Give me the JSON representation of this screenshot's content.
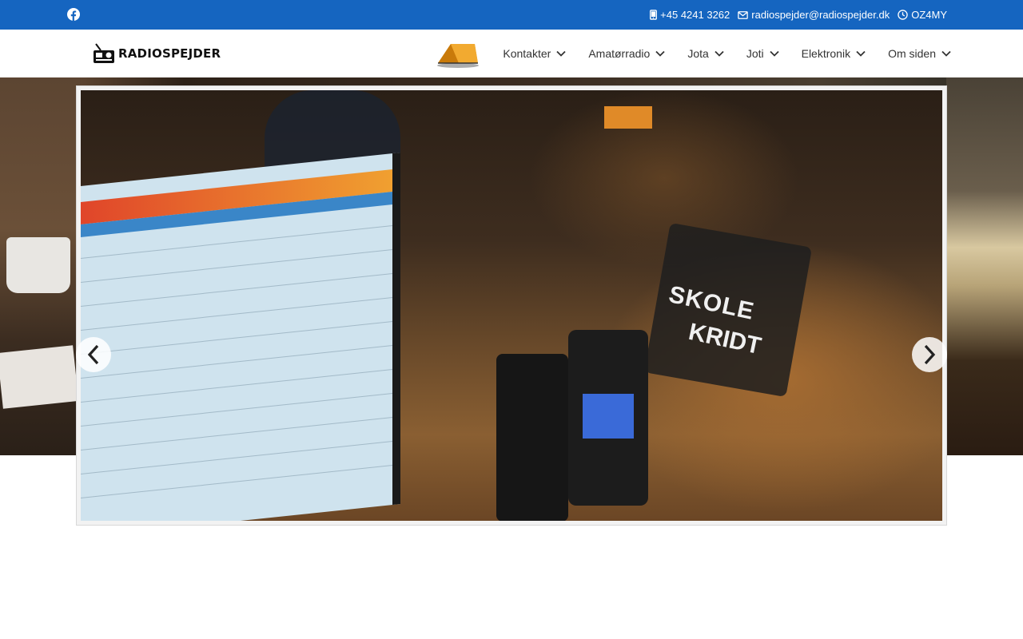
{
  "topbar": {
    "phone": "+45 4241 3262",
    "email": "radiospejder@radiospejder.dk",
    "callsign": "OZ4MY",
    "bg_color": "#1565c0"
  },
  "brand": {
    "logo_text": "RADIOSPEJDER"
  },
  "nav": {
    "items": [
      {
        "label": "Kontakter"
      },
      {
        "label": "Amatørradio"
      },
      {
        "label": "Jota"
      },
      {
        "label": "Joti"
      },
      {
        "label": "Elektronik"
      },
      {
        "label": "Om siden"
      }
    ]
  },
  "slider": {
    "photo_text_1": "SKOLE",
    "photo_text_2": "KRIDT"
  },
  "icons": {
    "facebook": "facebook-icon",
    "phone": "phone-icon",
    "email": "envelope-icon",
    "clock": "clock-icon",
    "chevron": "chevron-down-icon",
    "prev": "chevron-left-icon",
    "next": "chevron-right-icon"
  }
}
